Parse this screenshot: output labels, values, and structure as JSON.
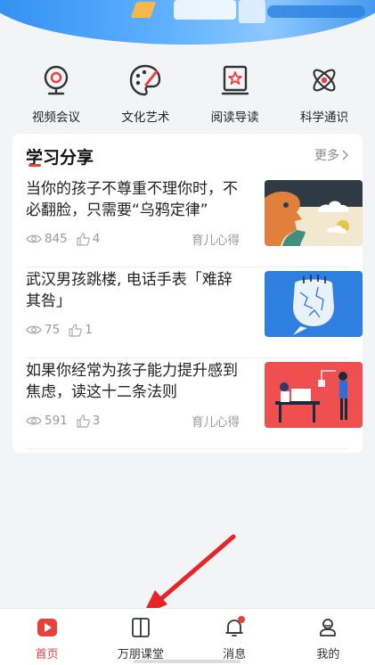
{
  "quick_nav": [
    {
      "label": "视频会议",
      "icon": "webcam-icon"
    },
    {
      "label": "文化艺术",
      "icon": "palette-icon"
    },
    {
      "label": "阅读导读",
      "icon": "book-icon"
    },
    {
      "label": "科学通识",
      "icon": "atom-icon"
    }
  ],
  "section": {
    "title": "学习分享",
    "more_label": "更多"
  },
  "articles": [
    {
      "title": "当你的孩子不尊重不理你时，不必翻脸，只需要“乌鸦定律”",
      "views": "845",
      "likes": "4",
      "tag": "育儿心得"
    },
    {
      "title": "武汉男孩跳楼, 电话手表「难辞其咎」",
      "views": "75",
      "likes": "1",
      "tag": ""
    },
    {
      "title": "如果你经常为孩子能力提升感到焦虑，读这十二条法则",
      "views": "591",
      "likes": "3",
      "tag": "育儿心得"
    }
  ],
  "tabbar": [
    {
      "label": "首页",
      "icon": "play-home-icon",
      "active": true
    },
    {
      "label": "万朋课堂",
      "icon": "open-book-icon",
      "active": false
    },
    {
      "label": "消息",
      "icon": "bell-icon",
      "active": false
    },
    {
      "label": "我的",
      "icon": "user-icon",
      "active": false
    }
  ],
  "colors": {
    "accent": "#e8413b",
    "banner_blue": "#2f8ef0",
    "text_gray": "#999999"
  }
}
